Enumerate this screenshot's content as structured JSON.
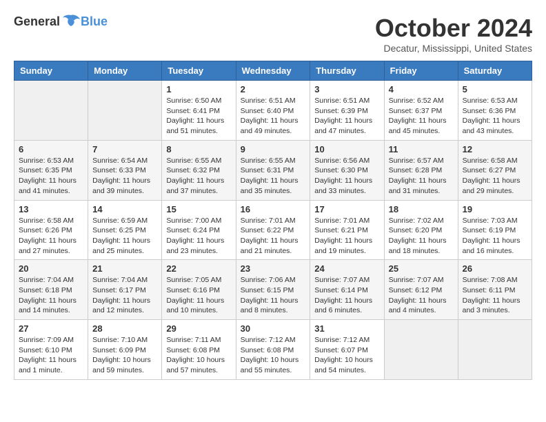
{
  "header": {
    "logo_general": "General",
    "logo_blue": "Blue",
    "title": "October 2024",
    "location": "Decatur, Mississippi, United States"
  },
  "days_of_week": [
    "Sunday",
    "Monday",
    "Tuesday",
    "Wednesday",
    "Thursday",
    "Friday",
    "Saturday"
  ],
  "weeks": [
    [
      {
        "day": "",
        "info": ""
      },
      {
        "day": "",
        "info": ""
      },
      {
        "day": "1",
        "info": "Sunrise: 6:50 AM\nSunset: 6:41 PM\nDaylight: 11 hours and 51 minutes."
      },
      {
        "day": "2",
        "info": "Sunrise: 6:51 AM\nSunset: 6:40 PM\nDaylight: 11 hours and 49 minutes."
      },
      {
        "day": "3",
        "info": "Sunrise: 6:51 AM\nSunset: 6:39 PM\nDaylight: 11 hours and 47 minutes."
      },
      {
        "day": "4",
        "info": "Sunrise: 6:52 AM\nSunset: 6:37 PM\nDaylight: 11 hours and 45 minutes."
      },
      {
        "day": "5",
        "info": "Sunrise: 6:53 AM\nSunset: 6:36 PM\nDaylight: 11 hours and 43 minutes."
      }
    ],
    [
      {
        "day": "6",
        "info": "Sunrise: 6:53 AM\nSunset: 6:35 PM\nDaylight: 11 hours and 41 minutes."
      },
      {
        "day": "7",
        "info": "Sunrise: 6:54 AM\nSunset: 6:33 PM\nDaylight: 11 hours and 39 minutes."
      },
      {
        "day": "8",
        "info": "Sunrise: 6:55 AM\nSunset: 6:32 PM\nDaylight: 11 hours and 37 minutes."
      },
      {
        "day": "9",
        "info": "Sunrise: 6:55 AM\nSunset: 6:31 PM\nDaylight: 11 hours and 35 minutes."
      },
      {
        "day": "10",
        "info": "Sunrise: 6:56 AM\nSunset: 6:30 PM\nDaylight: 11 hours and 33 minutes."
      },
      {
        "day": "11",
        "info": "Sunrise: 6:57 AM\nSunset: 6:28 PM\nDaylight: 11 hours and 31 minutes."
      },
      {
        "day": "12",
        "info": "Sunrise: 6:58 AM\nSunset: 6:27 PM\nDaylight: 11 hours and 29 minutes."
      }
    ],
    [
      {
        "day": "13",
        "info": "Sunrise: 6:58 AM\nSunset: 6:26 PM\nDaylight: 11 hours and 27 minutes."
      },
      {
        "day": "14",
        "info": "Sunrise: 6:59 AM\nSunset: 6:25 PM\nDaylight: 11 hours and 25 minutes."
      },
      {
        "day": "15",
        "info": "Sunrise: 7:00 AM\nSunset: 6:24 PM\nDaylight: 11 hours and 23 minutes."
      },
      {
        "day": "16",
        "info": "Sunrise: 7:01 AM\nSunset: 6:22 PM\nDaylight: 11 hours and 21 minutes."
      },
      {
        "day": "17",
        "info": "Sunrise: 7:01 AM\nSunset: 6:21 PM\nDaylight: 11 hours and 19 minutes."
      },
      {
        "day": "18",
        "info": "Sunrise: 7:02 AM\nSunset: 6:20 PM\nDaylight: 11 hours and 18 minutes."
      },
      {
        "day": "19",
        "info": "Sunrise: 7:03 AM\nSunset: 6:19 PM\nDaylight: 11 hours and 16 minutes."
      }
    ],
    [
      {
        "day": "20",
        "info": "Sunrise: 7:04 AM\nSunset: 6:18 PM\nDaylight: 11 hours and 14 minutes."
      },
      {
        "day": "21",
        "info": "Sunrise: 7:04 AM\nSunset: 6:17 PM\nDaylight: 11 hours and 12 minutes."
      },
      {
        "day": "22",
        "info": "Sunrise: 7:05 AM\nSunset: 6:16 PM\nDaylight: 11 hours and 10 minutes."
      },
      {
        "day": "23",
        "info": "Sunrise: 7:06 AM\nSunset: 6:15 PM\nDaylight: 11 hours and 8 minutes."
      },
      {
        "day": "24",
        "info": "Sunrise: 7:07 AM\nSunset: 6:14 PM\nDaylight: 11 hours and 6 minutes."
      },
      {
        "day": "25",
        "info": "Sunrise: 7:07 AM\nSunset: 6:12 PM\nDaylight: 11 hours and 4 minutes."
      },
      {
        "day": "26",
        "info": "Sunrise: 7:08 AM\nSunset: 6:11 PM\nDaylight: 11 hours and 3 minutes."
      }
    ],
    [
      {
        "day": "27",
        "info": "Sunrise: 7:09 AM\nSunset: 6:10 PM\nDaylight: 11 hours and 1 minute."
      },
      {
        "day": "28",
        "info": "Sunrise: 7:10 AM\nSunset: 6:09 PM\nDaylight: 10 hours and 59 minutes."
      },
      {
        "day": "29",
        "info": "Sunrise: 7:11 AM\nSunset: 6:08 PM\nDaylight: 10 hours and 57 minutes."
      },
      {
        "day": "30",
        "info": "Sunrise: 7:12 AM\nSunset: 6:08 PM\nDaylight: 10 hours and 55 minutes."
      },
      {
        "day": "31",
        "info": "Sunrise: 7:12 AM\nSunset: 6:07 PM\nDaylight: 10 hours and 54 minutes."
      },
      {
        "day": "",
        "info": ""
      },
      {
        "day": "",
        "info": ""
      }
    ]
  ]
}
